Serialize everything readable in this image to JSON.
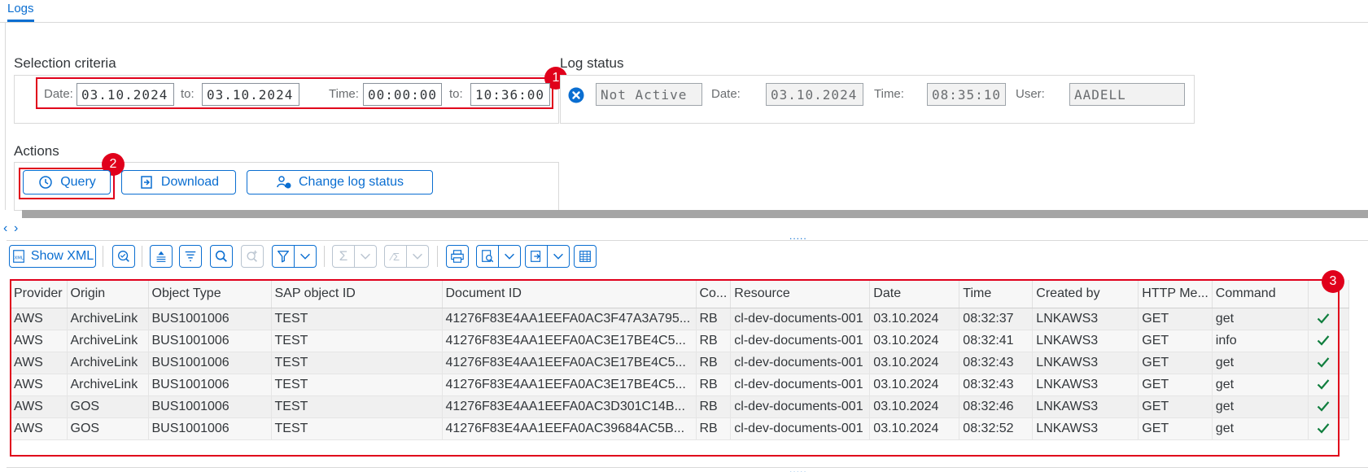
{
  "tabs": [
    {
      "label": "Logs"
    }
  ],
  "selection": {
    "title": "Selection criteria",
    "date_label": "Date:",
    "date_from": "03.10.2024",
    "to_label": "to:",
    "date_to": "03.10.2024",
    "time_label": "Time:",
    "time_from": "00:00:00",
    "time_to": "10:36:00"
  },
  "log_status": {
    "title": "Log status",
    "status": "Not Active",
    "date_label": "Date:",
    "date": "03.10.2024",
    "time_label": "Time:",
    "time": "08:35:10",
    "user_label": "User:",
    "user": "AADELL"
  },
  "actions": {
    "title": "Actions",
    "query_label": "Query",
    "download_label": "Download",
    "change_status_label": "Change log status"
  },
  "callouts": [
    "1",
    "2",
    "3"
  ],
  "splitter": {
    "left_arrow": "‹",
    "right_arrow": "›",
    "grip": "....."
  },
  "toolbar": {
    "show_xml_label": "Show XML",
    "sum_symbol": "Σ",
    "subtotal_symbol": "⁄Σ"
  },
  "grid": {
    "columns": [
      "Provider",
      "Origin",
      "Object Type",
      "SAP object ID",
      "Document ID",
      "Co...",
      "Resource",
      "Date",
      "Time",
      "Created by",
      "HTTP Me...",
      "Command",
      ""
    ],
    "rows": [
      [
        "AWS",
        "ArchiveLink",
        "BUS1001006",
        "TEST",
        "41276F83E4AA1EEFA0AC3F47A3A795...",
        "RB",
        "cl-dev-documents-001",
        "03.10.2024",
        "08:32:37",
        "LNKAWS3",
        "GET",
        "get"
      ],
      [
        "AWS",
        "ArchiveLink",
        "BUS1001006",
        "TEST",
        "41276F83E4AA1EEFA0AC3E17BE4C5...",
        "RB",
        "cl-dev-documents-001",
        "03.10.2024",
        "08:32:41",
        "LNKAWS3",
        "GET",
        "info"
      ],
      [
        "AWS",
        "ArchiveLink",
        "BUS1001006",
        "TEST",
        "41276F83E4AA1EEFA0AC3E17BE4C5...",
        "RB",
        "cl-dev-documents-001",
        "03.10.2024",
        "08:32:43",
        "LNKAWS3",
        "GET",
        "get"
      ],
      [
        "AWS",
        "ArchiveLink",
        "BUS1001006",
        "TEST",
        "41276F83E4AA1EEFA0AC3E17BE4C5...",
        "RB",
        "cl-dev-documents-001",
        "03.10.2024",
        "08:32:43",
        "LNKAWS3",
        "GET",
        "get"
      ],
      [
        "AWS",
        "GOS",
        "BUS1001006",
        "TEST",
        "41276F83E4AA1EEFA0AC3D301C14B...",
        "RB",
        "cl-dev-documents-001",
        "03.10.2024",
        "08:32:46",
        "LNKAWS3",
        "GET",
        "get"
      ],
      [
        "AWS",
        "GOS",
        "BUS1001006",
        "TEST",
        "41276F83E4AA1EEFA0AC39684AC5B...",
        "RB",
        "cl-dev-documents-001",
        "03.10.2024",
        "08:32:52",
        "LNKAWS3",
        "GET",
        "get"
      ]
    ],
    "status_icon": "check-icon"
  },
  "colors": {
    "accent": "#0a6ed1",
    "callout": "#e0001b",
    "success": "#107e3e"
  }
}
